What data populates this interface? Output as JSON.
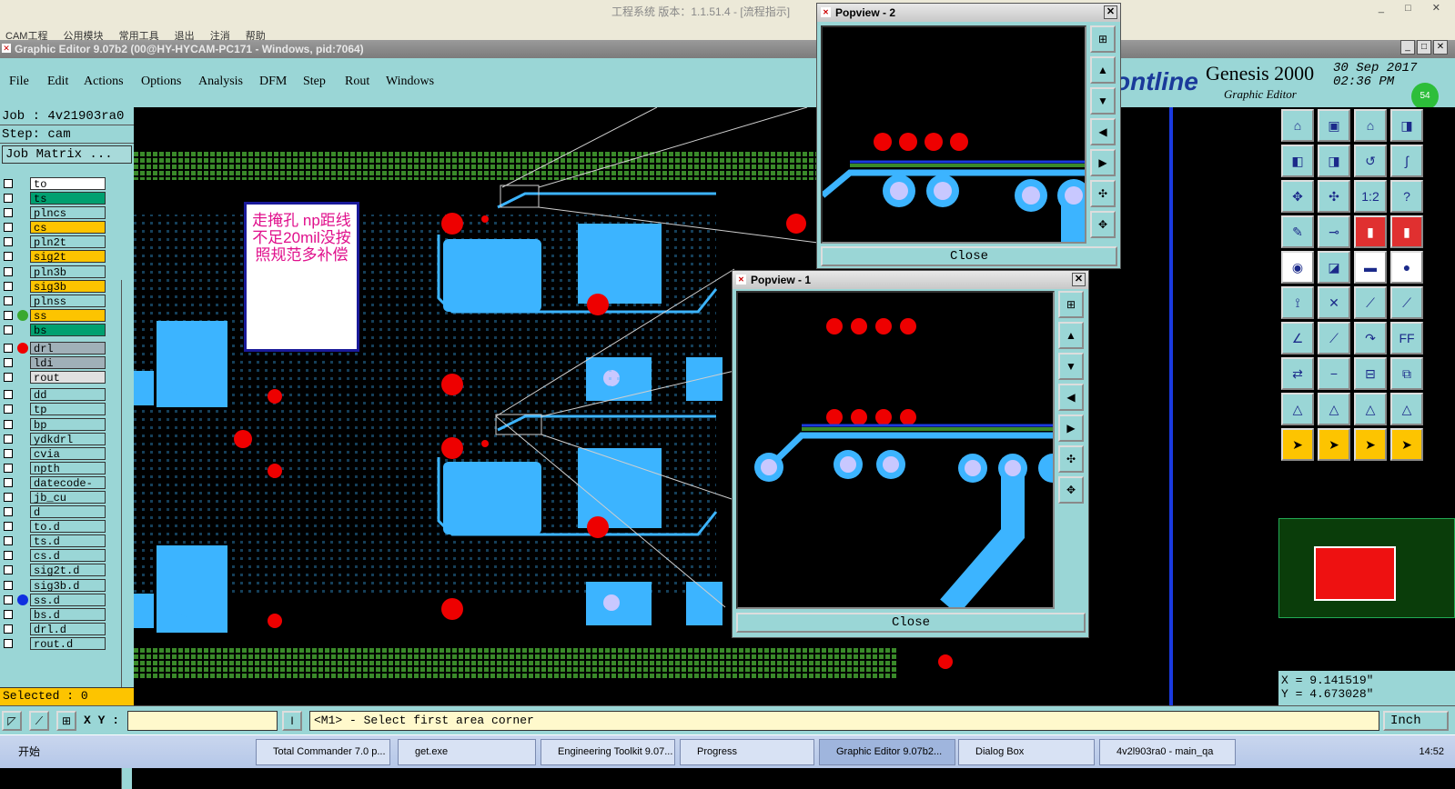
{
  "top_window": {
    "title": "工程系统   版本：1.1.51.4 - [流程指示]",
    "menus": [
      "CAM工程",
      "公用模块",
      "常用工具",
      "退出",
      "注消",
      "帮助"
    ]
  },
  "editor": {
    "title": "Graphic Editor 9.07b2 (00@HY-HYCAM-PC171 - Windows, pid:7064)",
    "menus": [
      "File",
      "Edit",
      "Actions",
      "Options",
      "Analysis",
      "DFM",
      "Step",
      "Rout",
      "Windows"
    ],
    "brand": {
      "logo": "ontline",
      "product": "Genesis 2000",
      "subtitle": "Graphic Editor",
      "date": "30 Sep 2017",
      "time": "02:36 PM",
      "indicator": "54"
    }
  },
  "left_panel": {
    "job": "Job : 4v21903ra0",
    "step": "Step: cam",
    "job_matrix": "Job Matrix ...",
    "layers": [
      {
        "name": "to",
        "color": "#ffffff",
        "dot": ""
      },
      {
        "name": "ts",
        "color": "#00a070",
        "dot": ""
      },
      {
        "name": "plncs",
        "color": "#9ad6d6",
        "dot": ""
      },
      {
        "name": "cs",
        "color": "#fdc400",
        "dot": ""
      },
      {
        "name": "pln2t",
        "color": "#9ad6d6",
        "dot": ""
      },
      {
        "name": "sig2t",
        "color": "#fdc400",
        "dot": ""
      },
      {
        "name": "pln3b",
        "color": "#9ad6d6",
        "dot": ""
      },
      {
        "name": "sig3b",
        "color": "#fdc400",
        "dot": ""
      },
      {
        "name": "plnss",
        "color": "#9ad6d6",
        "dot": ""
      },
      {
        "name": "ss",
        "color": "#fdc400",
        "dot": "#3aa830"
      },
      {
        "name": "bs",
        "color": "#00a070",
        "dot": ""
      },
      {
        "name": "drl",
        "color": "#a0b0b8",
        "dot": "#ee0000"
      },
      {
        "name": "ldi",
        "color": "#a0b0b8",
        "dot": ""
      },
      {
        "name": "rout",
        "color": "#e0e0e0",
        "dot": ""
      },
      {
        "name": "dd",
        "color": "#9ad6d6",
        "dot": ""
      },
      {
        "name": "tp",
        "color": "#9ad6d6",
        "dot": ""
      },
      {
        "name": "bp",
        "color": "#9ad6d6",
        "dot": ""
      },
      {
        "name": "ydkdrl",
        "color": "#9ad6d6",
        "dot": ""
      },
      {
        "name": "cvia",
        "color": "#9ad6d6",
        "dot": ""
      },
      {
        "name": "npth",
        "color": "#9ad6d6",
        "dot": ""
      },
      {
        "name": "datecode-ts",
        "color": "#9ad6d6",
        "dot": ""
      },
      {
        "name": "jb_cu",
        "color": "#9ad6d6",
        "dot": ""
      },
      {
        "name": "d",
        "color": "#9ad6d6",
        "dot": ""
      },
      {
        "name": "to.d",
        "color": "#9ad6d6",
        "dot": ""
      },
      {
        "name": "ts.d",
        "color": "#9ad6d6",
        "dot": ""
      },
      {
        "name": "cs.d",
        "color": "#9ad6d6",
        "dot": ""
      },
      {
        "name": "sig2t.d",
        "color": "#9ad6d6",
        "dot": ""
      },
      {
        "name": "sig3b.d",
        "color": "#9ad6d6",
        "dot": ""
      },
      {
        "name": "ss.d",
        "color": "#9ad6d6",
        "dot": "#1030e0"
      },
      {
        "name": "bs.d",
        "color": "#9ad6d6",
        "dot": ""
      },
      {
        "name": "drl.d",
        "color": "#9ad6d6",
        "dot": ""
      },
      {
        "name": "rout.d",
        "color": "#9ad6d6",
        "dot": ""
      }
    ],
    "selected": "Selected : 0"
  },
  "annotation_note": "走掩孔 np距线不足20mil没按照规范多补偿",
  "popview2": {
    "title": "Popview - 2",
    "close": "Close"
  },
  "popview1": {
    "title": "Popview - 1",
    "close": "Close"
  },
  "coords": {
    "x": "X = 9.141519\"",
    "y": "Y = 4.673028\""
  },
  "status": {
    "xy_label": "X Y :",
    "xy_value": "",
    "message": "<M1> - Select first area corner",
    "unit": "Inch"
  },
  "taskbar": {
    "start": "开始",
    "items": [
      "Total Commander 7.0 p...",
      "get.exe",
      "Engineering Toolkit 9.07...",
      "Progress",
      "Graphic Editor 9.07b2...",
      "Dialog Box",
      "4v2l903ra0 - main_qa"
    ],
    "clock": "14:52"
  },
  "colors": {
    "panel": "#9ad6d6",
    "copper": "#3cb4ff",
    "drill": "#ee0000",
    "green_grid": "#3a8a2a"
  }
}
